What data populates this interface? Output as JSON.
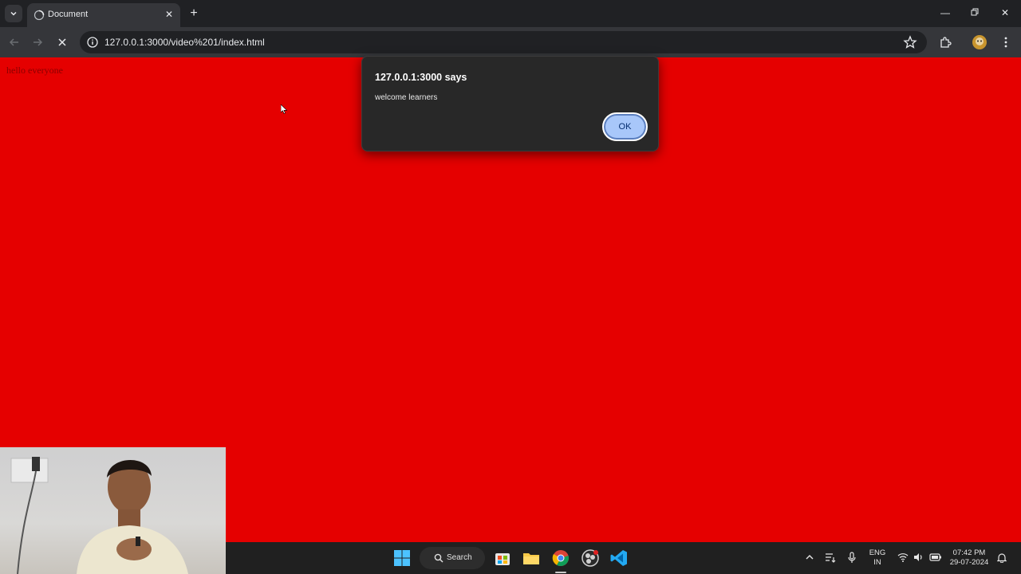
{
  "tab": {
    "title": "Document",
    "close": "✕"
  },
  "toolbar": {
    "url": "127.0.0.1:3000/video%201/index.html"
  },
  "page": {
    "text": "hello everyone"
  },
  "dialog": {
    "title": "127.0.0.1:3000 says",
    "message": "welcome learners",
    "ok_label": "OK"
  },
  "taskbar": {
    "search_label": "Search",
    "lang_line1": "ENG",
    "lang_line2": "IN",
    "time": "07:42 PM",
    "date": "29-07-2024"
  },
  "colors": {
    "page_bg": "#e50000",
    "dialog_bg": "#282828",
    "ok_bg": "#a8c7fa"
  }
}
